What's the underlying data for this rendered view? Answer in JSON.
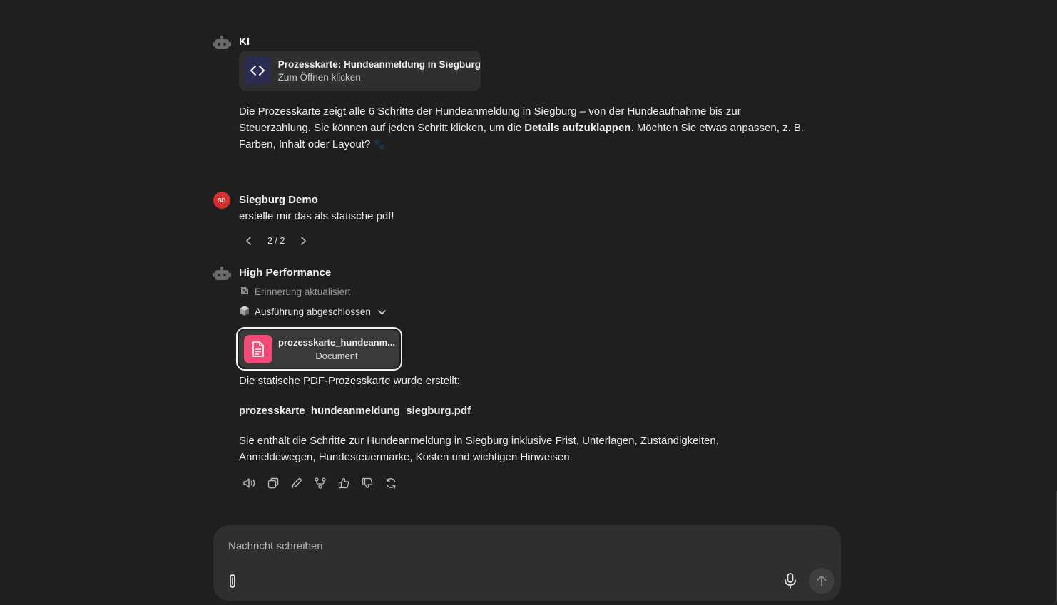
{
  "messages": {
    "ai_1": {
      "sender": "KI",
      "artifact": {
        "title": "Prozesskarte: Hundeanmeldung in Siegburg",
        "subtitle": "Zum Öffnen klicken",
        "icon": "code-icon"
      },
      "text_part1": "Die Prozesskarte zeigt alle 6 Schritte der Hundeanmeldung in Siegburg – von der Hundeaufnahme bis zur Steuerzahlung. Sie können auf jeden Schritt klicken, um die ",
      "text_bold": "Details aufzuklappen",
      "text_part2": ". Möchten Sie etwas anpassen, z. B. Farben, Inhalt oder Layout?",
      "emoji": "🐾"
    },
    "user_1": {
      "initials": "SD",
      "sender": "Siegburg Demo",
      "text": "erstelle mir das als statische pdf!",
      "pager": "2 / 2"
    },
    "ai_2": {
      "sender": "High Performance",
      "memory_status": "Erinnerung aktualisiert",
      "execution_status": "Ausführung abgeschlossen",
      "file": {
        "name": "prozesskarte_hundeanm...",
        "type": "Document"
      },
      "line1": "Die statische PDF-Prozesskarte wurde erstellt:",
      "filename": "prozesskarte_hundeanmeldung_siegburg.pdf",
      "line3": "Sie enthält die Schritte zur Hundeanmeldung in Siegburg inklusive Frist, Unterlagen, Zuständigkeiten, Anmeldewegen, Hundesteuermarke, Kosten und wichtigen Hinweisen."
    }
  },
  "actions": [
    "speaker-icon",
    "copy-icon",
    "edit-icon",
    "branch-icon",
    "thumbs-up-icon",
    "thumbs-down-icon",
    "regenerate-icon"
  ],
  "composer": {
    "placeholder": "Nachricht schreiben"
  },
  "colors": {
    "background": "#1f1f1f",
    "surface": "#2f2f2f",
    "user_avatar": "#d32f2f",
    "file_icon": "#ef4d78",
    "artifact_icon": "#2b2d52"
  }
}
